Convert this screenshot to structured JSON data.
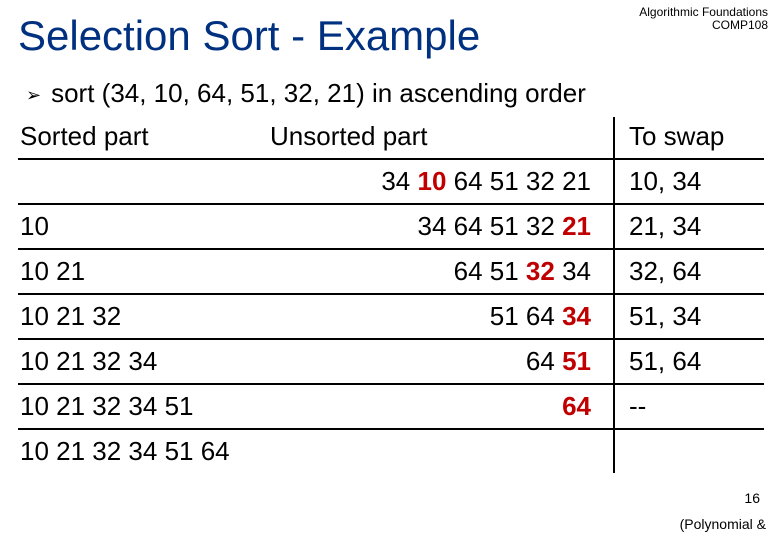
{
  "header": {
    "course_line1": "Algorithmic Foundations",
    "course_line2": "COMP108"
  },
  "title": "Selection Sort - Example",
  "subtitle": "sort (34, 10, 64, 51, 32, 21) in ascending order",
  "columns": {
    "sorted": "Sorted part",
    "unsorted": "Unsorted part",
    "swap": "To swap"
  },
  "rows": [
    {
      "sorted": "",
      "unsorted_pre": "34 ",
      "unsorted_hl": "10",
      "unsorted_post": " 64 51 32 21",
      "swap": "10, 34"
    },
    {
      "sorted": "10",
      "unsorted_pre": "34 64 51 32 ",
      "unsorted_hl": "21",
      "unsorted_post": "",
      "swap": "21, 34"
    },
    {
      "sorted": "10 21",
      "unsorted_pre": "64 51 ",
      "unsorted_hl": "32",
      "unsorted_post": " 34",
      "swap": "32, 64"
    },
    {
      "sorted": "10 21 32",
      "unsorted_pre": "51 64 ",
      "unsorted_hl": "34",
      "unsorted_post": "",
      "swap": "51, 34"
    },
    {
      "sorted": "10 21 32 34",
      "unsorted_pre": "64 ",
      "unsorted_hl": "51",
      "unsorted_post": "",
      "swap": "51, 64"
    },
    {
      "sorted": "10 21 32 34 51",
      "unsorted_pre": "",
      "unsorted_hl": "64",
      "unsorted_post": "",
      "swap": "--"
    },
    {
      "sorted": "10 21 32 34 51 64",
      "unsorted_pre": "",
      "unsorted_hl": "",
      "unsorted_post": "",
      "swap": ""
    }
  ],
  "footer": {
    "page_number": "16",
    "topic_fragment": "(Polynomial &"
  }
}
